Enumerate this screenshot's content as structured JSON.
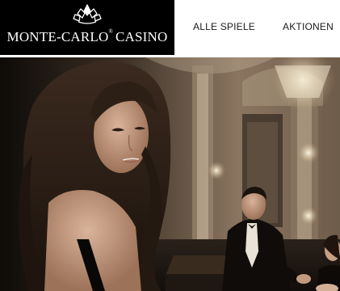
{
  "header": {
    "logo": {
      "brand": "MONTE-CARLO",
      "registered_mark": "®",
      "suffix": "CASINO",
      "emblem_icon": "crown-emblem-icon"
    },
    "nav": {
      "items": [
        {
          "label": "ALLE SPIELE"
        },
        {
          "label": "AKTIONEN"
        }
      ]
    }
  },
  "hero": {
    "subject": "casino-interior-photo",
    "colors": {
      "background_dark": "#1b1510",
      "wall_warm": "#8a7560",
      "chandelier_glow": "#f3ead6"
    }
  }
}
